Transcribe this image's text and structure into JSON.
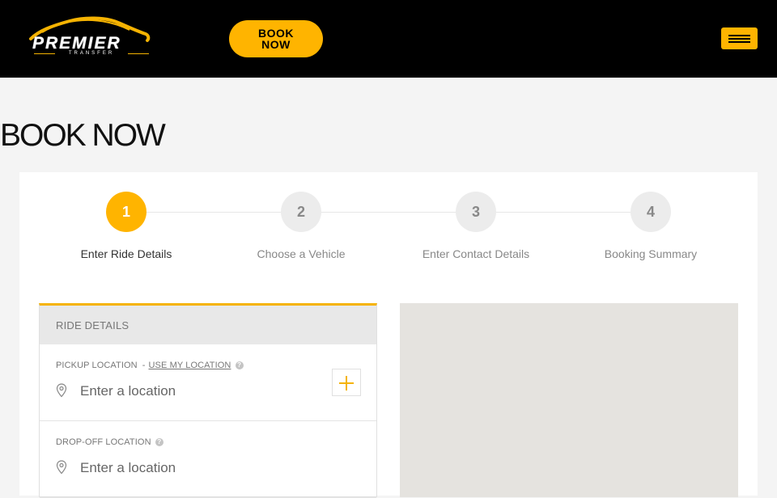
{
  "header": {
    "logo_text": "PREMIER",
    "logo_subtext": "TRANSFER",
    "book_button": "BOOK NOW",
    "accent_color": "#ffb400",
    "menu_icon": "hamburger-icon"
  },
  "page": {
    "title": "BOOK NOW"
  },
  "stepper": {
    "steps": [
      {
        "number": "1",
        "label": "Enter Ride Details"
      },
      {
        "number": "2",
        "label": "Choose a Vehicle"
      },
      {
        "number": "3",
        "label": "Enter Contact Details"
      },
      {
        "number": "4",
        "label": "Booking Summary"
      }
    ],
    "active_step": 1
  },
  "ride_details": {
    "heading": "RIDE DETAILS",
    "pickup": {
      "label": "PICKUP LOCATION",
      "separator": "-",
      "use_my_location": "USE MY LOCATION",
      "placeholder": "Enter a location",
      "value": ""
    },
    "dropoff": {
      "label": "DROP-OFF LOCATION",
      "placeholder": "Enter a location",
      "value": ""
    }
  }
}
